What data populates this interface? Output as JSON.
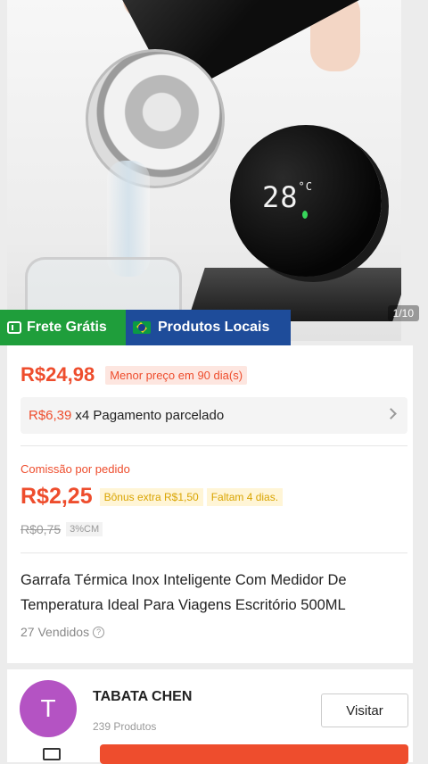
{
  "product_image": {
    "counter": "1/10",
    "display_temp": "28",
    "display_unit": "°C"
  },
  "badges": {
    "free_shipping": "Frete Grátis",
    "local_products": "Produtos Locais"
  },
  "price": {
    "current": "R$24,98",
    "lowest_badge": "Menor preço em 90 dia(s)",
    "installment_amount": "R$6,39",
    "installment_text": "x4 Pagamento parcelado"
  },
  "commission": {
    "label": "Comissão por pedido",
    "value": "R$2,25",
    "bonus": "Bônus extra R$1,50",
    "days_left": "Faltam 4 dias.",
    "old_value": "R$0,75",
    "rate": "3%CM"
  },
  "product": {
    "title": "Garrafa Térmica Inox Inteligente Com Medidor De Temperatura Ideal Para Viagens Escritório 500ML",
    "sold": "27 Vendidos"
  },
  "shop": {
    "avatar_letter": "T",
    "name": "TABATA CHEN",
    "products": "239 Produtos",
    "visit_label": "Visitar"
  },
  "colors": {
    "accent": "#ee4d2d",
    "free_shipping_bg": "#1f9e3b",
    "local_bg": "#1e4c9a",
    "avatar": "#b453c3"
  }
}
